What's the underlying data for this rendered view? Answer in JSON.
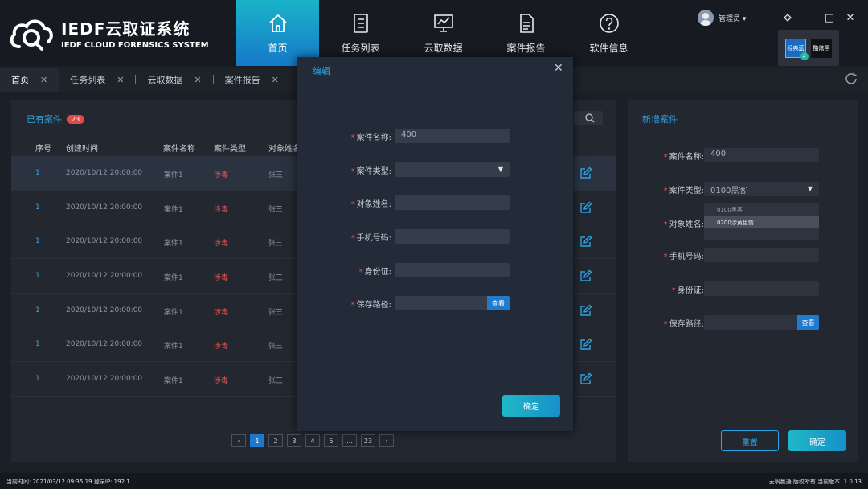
{
  "app": {
    "title": "IEDF云取证系统",
    "subtitle": "IEDF CLOUD FORENSICS SYSTEM"
  },
  "nav": [
    {
      "label": "首页",
      "icon": "home-icon",
      "active": true
    },
    {
      "label": "任务列表",
      "icon": "list-icon",
      "active": false
    },
    {
      "label": "云取数据",
      "icon": "chart-board-icon",
      "active": false
    },
    {
      "label": "案件报告",
      "icon": "document-icon",
      "active": false
    },
    {
      "label": "软件信息",
      "icon": "question-icon",
      "active": false
    }
  ],
  "user": {
    "name": "管理员 ▾"
  },
  "theme": {
    "classic": "经典蓝",
    "dark": "酷炫黑"
  },
  "tabs": [
    {
      "label": "首页"
    },
    {
      "label": "任务列表"
    },
    {
      "label": "云取数据"
    },
    {
      "label": "案件报告"
    }
  ],
  "cases": {
    "title": "已有案件",
    "count": "23",
    "columns": [
      "序号",
      "创建时间",
      "案件名称",
      "案件类型",
      "对象姓名"
    ],
    "rows": [
      {
        "idx": "1",
        "time": "2020/10/12 20:00:00",
        "name": "案件1",
        "type": "涉毒",
        "person": "张三"
      },
      {
        "idx": "1",
        "time": "2020/10/12 20:00:00",
        "name": "案件1",
        "type": "涉毒",
        "person": "张三"
      },
      {
        "idx": "1",
        "time": "2020/10/12 20:00:00",
        "name": "案件1",
        "type": "涉毒",
        "person": "张三"
      },
      {
        "idx": "1",
        "time": "2020/10/12 20:00:00",
        "name": "案件1",
        "type": "涉毒",
        "person": "张三"
      },
      {
        "idx": "1",
        "time": "2020/10/12 20:00:00",
        "name": "案件1",
        "type": "涉毒",
        "person": "张三"
      },
      {
        "idx": "1",
        "time": "2020/10/12 20:00:00",
        "name": "案件1",
        "type": "涉毒",
        "person": "张三"
      },
      {
        "idx": "1",
        "time": "2020/10/12 20:00:00",
        "name": "案件1",
        "type": "涉毒",
        "person": "张三"
      }
    ],
    "pager": {
      "prev": "‹",
      "pages": [
        "1",
        "2",
        "3",
        "4",
        "5",
        "…",
        "23"
      ],
      "next": "›"
    }
  },
  "new_case": {
    "title": "新增案件",
    "labels": {
      "name": "案件名称:",
      "type": "案件类型:",
      "person": "对象姓名:",
      "phone": "手机号码:",
      "id": "身份证:",
      "path": "保存路径:"
    },
    "values": {
      "name": "400",
      "type": "0100黑客"
    },
    "options": [
      "0100黑客",
      "0200涉黄色情"
    ],
    "view": "查看",
    "reset": "重置",
    "confirm": "确定"
  },
  "modal": {
    "title": "编辑",
    "close": "✕",
    "labels": {
      "name": "案件名称:",
      "type": "案件类型:",
      "person": "对象姓名:",
      "phone": "手机号码:",
      "id": "身份证:",
      "path": "保存路径:"
    },
    "values": {
      "name": "400"
    },
    "view": "查看",
    "confirm": "确定"
  },
  "status": {
    "left": "当前时间: 2021/03/12 09:35:19  登录IP: 192.1",
    "right": "云帆赢通 版权所有 当前版本: 1.0.13"
  },
  "colors": {
    "accent": "#2ea4e8",
    "danger": "#e05555",
    "nav_active": "#1b9bc9"
  }
}
